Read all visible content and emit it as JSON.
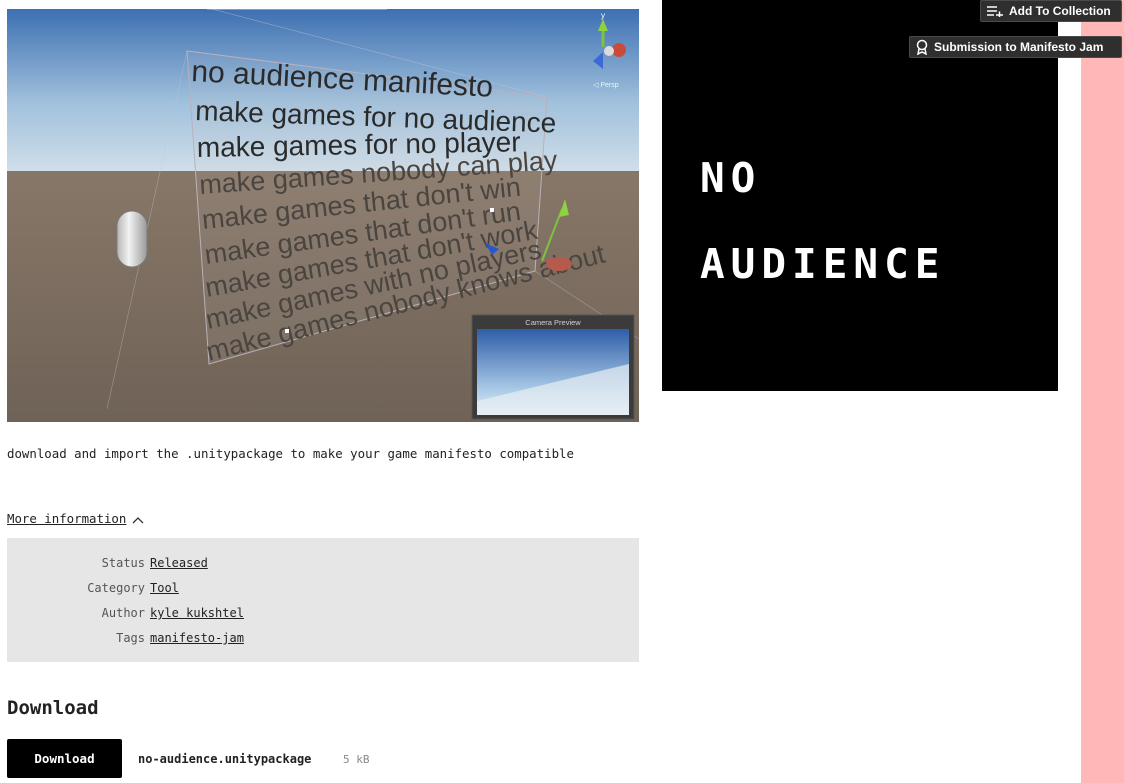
{
  "top_buttons": {
    "add_to_collection": "Add To Collection",
    "submission": "Submission to Manifesto Jam"
  },
  "screenshot": {
    "manifesto_lines": [
      "no audience manifesto",
      "make games for no audience",
      "make games for no player",
      "make games nobody can play",
      "make games that don't win",
      "make games that don't run",
      "make games that don't work",
      "make games with no players",
      "make games nobody knows about"
    ],
    "camera_preview_label": "Camera Preview",
    "persp_label": "◁ Persp",
    "gizmo_y_label": "y"
  },
  "cover": {
    "line1": "NO",
    "line2": "AUDIENCE"
  },
  "description": "download and import the .unitypackage to make your game manifesto compatible",
  "more_info": {
    "label": "More information",
    "rows": [
      {
        "key": "Status",
        "value": "Released"
      },
      {
        "key": "Category",
        "value": "Tool"
      },
      {
        "key": "Author",
        "value": "kyle kukshtel"
      },
      {
        "key": "Tags",
        "value": "manifesto-jam"
      }
    ]
  },
  "download": {
    "heading": "Download",
    "button_label": "Download",
    "file_name": "no-audience.unitypackage",
    "file_size": "5 kB"
  },
  "colors": {
    "side_strip": "#ffb7b8",
    "cover_bg": "#000000",
    "info_bg": "#e6e6e6"
  }
}
